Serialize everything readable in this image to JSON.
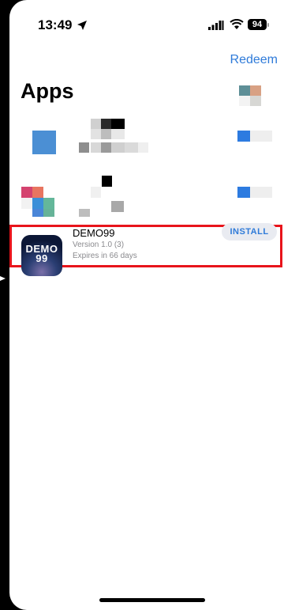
{
  "status_bar": {
    "time": "13:49",
    "battery": "94",
    "icons": [
      "location-arrow-icon",
      "cellular-signal-icon",
      "wifi-icon",
      "battery-icon"
    ]
  },
  "header": {
    "redeem_label": "Redeem",
    "title": "Apps"
  },
  "apps": [
    {
      "name": "DEMO99",
      "version": "Version 1.0 (3)",
      "expiry": "Expires in 66 days",
      "icon_text": "DEMO\n99",
      "action_label": "INSTALL"
    }
  ],
  "colors": {
    "accent": "#2f7bd9",
    "highlight": "#e8141b",
    "secondary_text": "#8a8a8e",
    "button_bg": "#e9ebf1"
  }
}
